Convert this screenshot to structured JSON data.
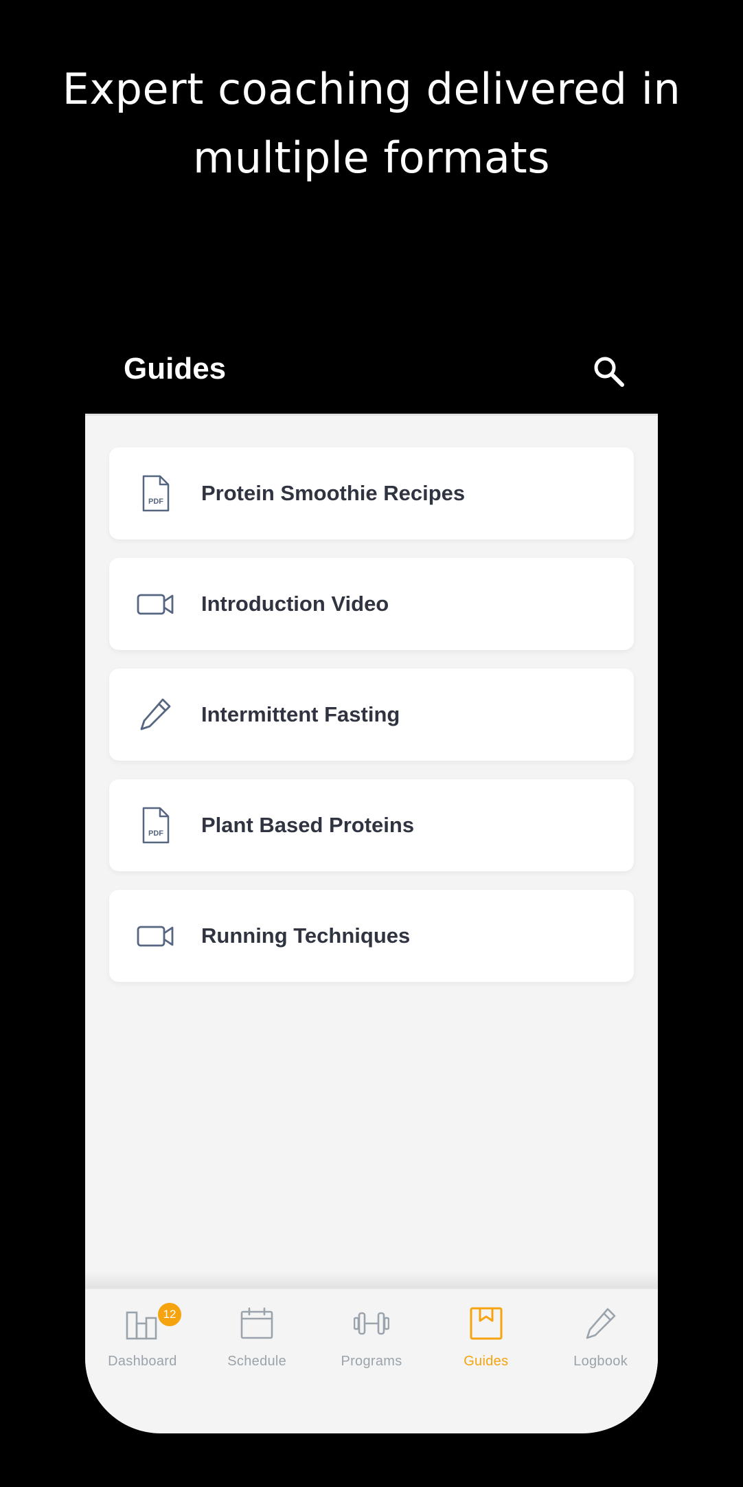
{
  "headline": "Expert coaching delivered in multiple formats",
  "app_bar": {
    "title": "Guides",
    "search_icon": "search-icon"
  },
  "guides": [
    {
      "label": "Protein Smoothie Recipes",
      "icon": "pdf-file-icon"
    },
    {
      "label": "Introduction Video",
      "icon": "video-camera-icon"
    },
    {
      "label": "Intermittent Fasting",
      "icon": "pencil-icon"
    },
    {
      "label": "Plant Based Proteins",
      "icon": "pdf-file-icon"
    },
    {
      "label": "Running Techniques",
      "icon": "video-camera-icon"
    }
  ],
  "tabbar": {
    "active": "Guides",
    "items": [
      {
        "label": "Dashboard",
        "icon": "bar-chart-icon",
        "badge": "12"
      },
      {
        "label": "Schedule",
        "icon": "calendar-icon"
      },
      {
        "label": "Programs",
        "icon": "dumbbell-icon"
      },
      {
        "label": "Guides",
        "icon": "bookmark-box-icon"
      },
      {
        "label": "Logbook",
        "icon": "pencil-icon"
      }
    ]
  },
  "colors": {
    "background": "#000000",
    "accent": "#f5a30f",
    "icon_slate": "#566580",
    "inactive_tab": "#9aa3ab",
    "content_bg": "#f4f4f4",
    "card_text": "#2f3440"
  }
}
